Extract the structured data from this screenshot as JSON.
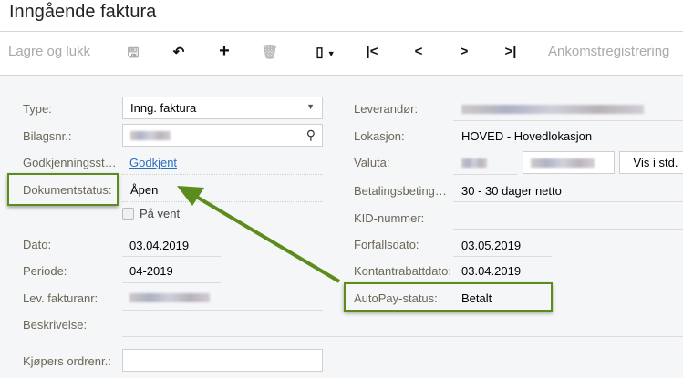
{
  "title": "Inngående faktura",
  "toolbar": {
    "save_close": "Lagre og lukk",
    "arrival": "Ankomstregistrering"
  },
  "left": {
    "type_label": "Type:",
    "type_value": "Inng. faktura",
    "bilag_label": "Bilagsnr.:",
    "godkj_label": "Godkjenningsst…",
    "godkj_value": "Godkjent",
    "dok_label": "Dokumentstatus:",
    "dok_value": "Åpen",
    "pavent_label": "På vent",
    "dato_label": "Dato:",
    "dato_value": "03.04.2019",
    "periode_label": "Periode:",
    "periode_value": "04-2019",
    "levfakt_label": "Lev. fakturanr:",
    "beskr_label": "Beskrivelse:",
    "kjopers_label": "Kjøpers ordrenr.:"
  },
  "right": {
    "lev_label": "Leverandør:",
    "lok_label": "Lokasjon:",
    "lok_value": "HOVED - Hovedlokasjon",
    "valuta_label": "Valuta:",
    "vis_button": "Vis i std.",
    "bet_label": "Betalingsbeting…",
    "bet_value": "30 - 30 dager netto",
    "kid_label": "KID-nummer:",
    "forfall_label": "Forfallsdato:",
    "forfall_value": "03.05.2019",
    "kontant_label": "Kontantrabattdato:",
    "kontant_value": "03.04.2019",
    "autopay_label": "AutoPay-status:",
    "autopay_value": "Betalt"
  },
  "colors": {
    "highlight": "#5b8c1c",
    "link": "#2a6fbf"
  }
}
